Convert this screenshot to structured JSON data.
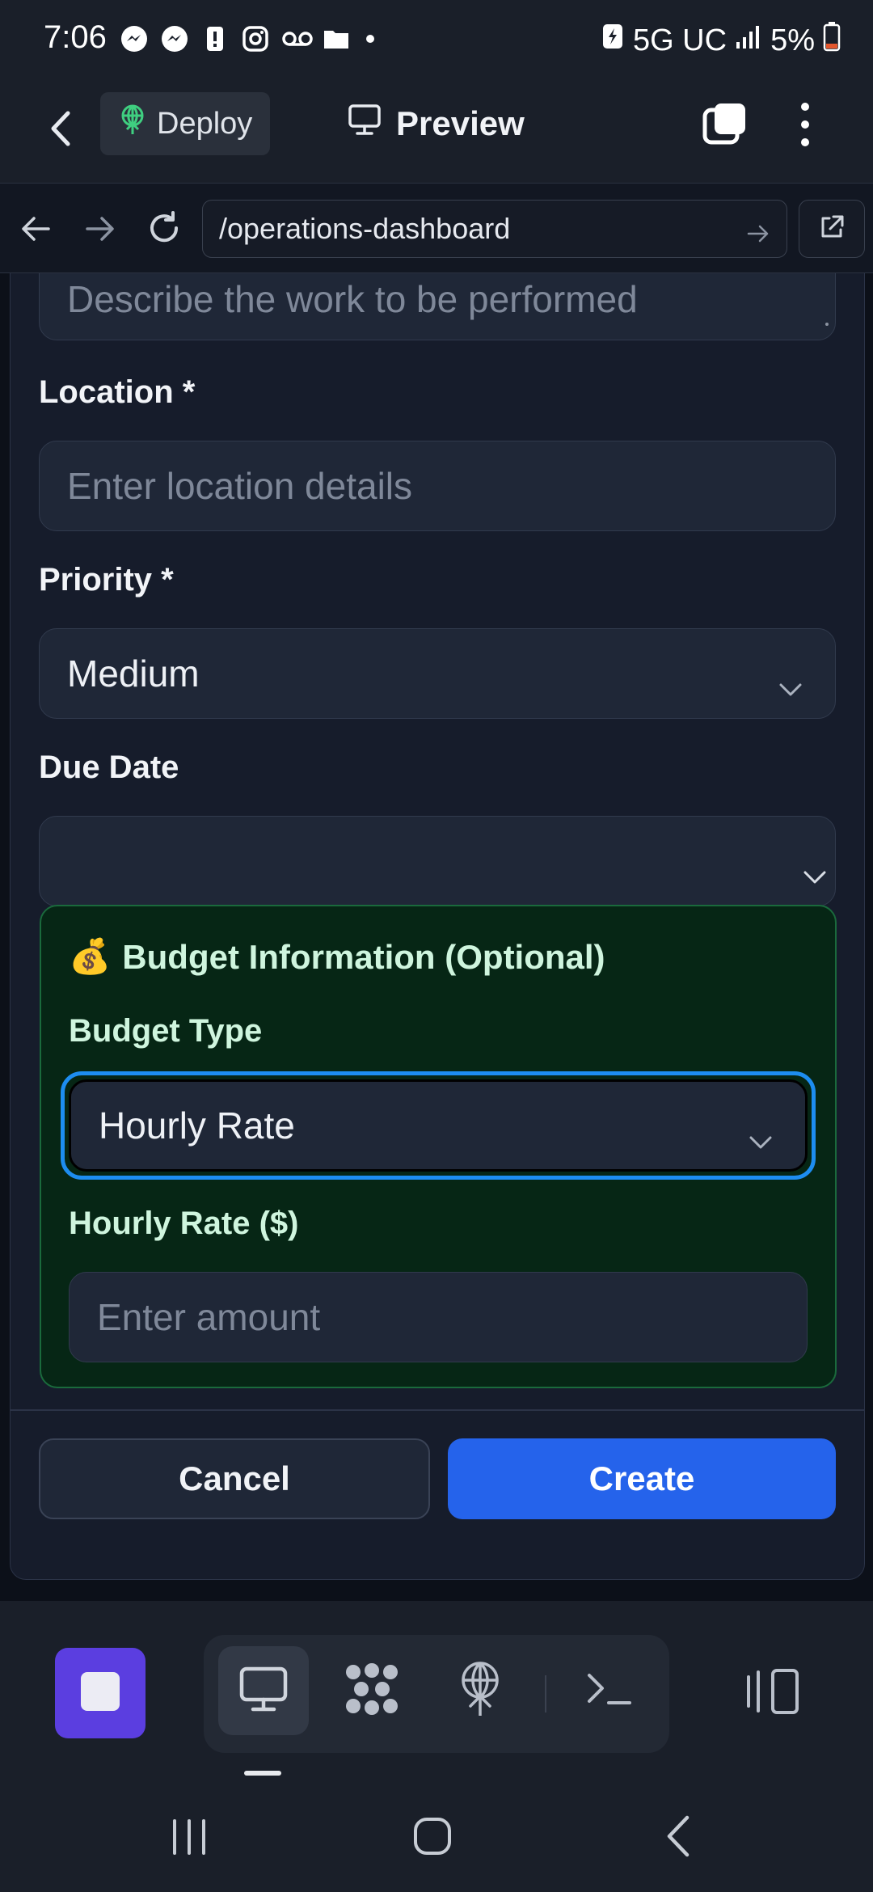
{
  "status_bar": {
    "time": "7:06",
    "network": "5G UC",
    "battery": "5%",
    "icons": [
      "messenger-icon",
      "messenger-icon",
      "alert-icon",
      "instagram-icon",
      "voicemail-icon",
      "folder-icon",
      "dot-icon"
    ]
  },
  "app_header": {
    "deploy_label": "Deploy",
    "preview_label": "Preview"
  },
  "browser": {
    "url": "/operations-dashboard"
  },
  "form": {
    "description_placeholder": "Describe the work to be performed",
    "location_label": "Location *",
    "location_placeholder": "Enter location details",
    "priority_label": "Priority *",
    "priority_value": "Medium",
    "due_date_label": "Due Date",
    "due_date_value": "",
    "budget": {
      "emoji": "💰",
      "title": "Budget Information (Optional)",
      "type_label": "Budget Type",
      "type_value": "Hourly Rate",
      "rate_label": "Hourly Rate ($)",
      "rate_placeholder": "Enter amount"
    },
    "cancel_label": "Cancel",
    "create_label": "Create"
  },
  "colors": {
    "accent_blue": "#2563eb",
    "budget_bg": "#062615",
    "budget_border": "#1a6a3c",
    "focus_ring": "#1d8df0",
    "stop_purple": "#5b3ee0"
  }
}
